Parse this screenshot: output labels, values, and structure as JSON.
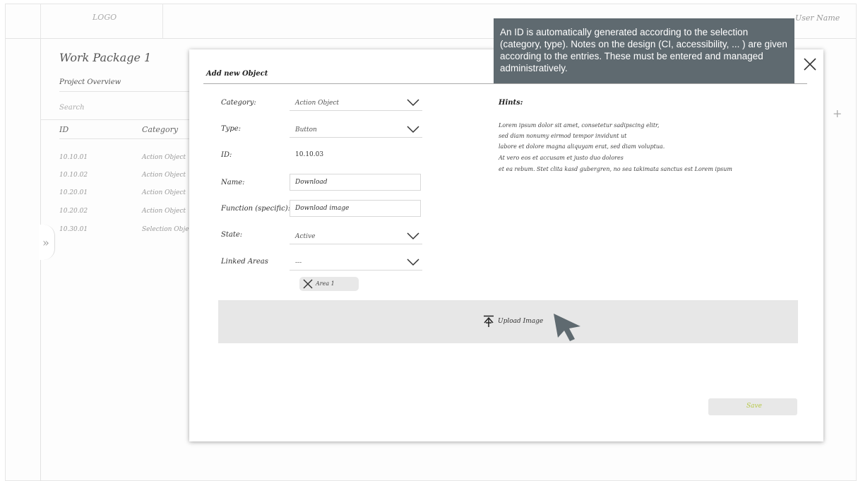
{
  "app": {
    "logo_text": "LOGO",
    "user_name": "User Name"
  },
  "sidebar": {
    "expand_icon": "double-chevron-right-icon",
    "expand_glyph": "»"
  },
  "background": {
    "work_package_title": "Work Package 1",
    "project_overview_label": "Project Overview",
    "search_placeholder": "Search",
    "add_icon": "+",
    "table": {
      "headers": [
        "ID",
        "Category"
      ],
      "rows": [
        [
          "10.10.01",
          "Action Object"
        ],
        [
          "10.10.02",
          "Action Object"
        ],
        [
          "10.20.01",
          "Action Object"
        ],
        [
          "10.20.02",
          "Action Object"
        ],
        [
          "10.30.01",
          "Selection Object"
        ]
      ]
    }
  },
  "modal": {
    "title": "Add new Object",
    "close_icon": "close-icon",
    "fields": {
      "category": {
        "label": "Category:",
        "value": "Action Object"
      },
      "type": {
        "label": "Type:",
        "value": "Button"
      },
      "id": {
        "label": "ID:",
        "value": "10.10.03"
      },
      "name": {
        "label": "Name:",
        "value": "Download"
      },
      "function": {
        "label": "Function (specific):",
        "value": "Download image"
      },
      "state": {
        "label": "State:",
        "value": "Active"
      },
      "linked_areas": {
        "label": "Linked Areas",
        "value": "---"
      }
    },
    "chip": {
      "label": "Area 1",
      "icon": "close-icon"
    },
    "hints": {
      "title": "Hints:",
      "lines": [
        "Lorem ipsum dolor sit amet, consetetur sadipscing elitr,",
        "sed diam nonumy eirmod tempor invidunt ut",
        "labore et dolore magna aliquyam erat, sed diam voluptua.",
        "At vero eos et accusam et justo duo dolores",
        "et ea rebum. Stet clita kasd gubergren, no sea takimata sanctus est Lorem ipsum"
      ]
    },
    "upload": {
      "label": "Upload Image",
      "icon": "upload-icon"
    },
    "save_label": "Save"
  },
  "tooltip": {
    "text": "An ID is automatically generated according to the selection (category, type). Notes on the design (CI, accessibility, ... ) are given according to the entries. These must be entered and managed administratively."
  },
  "colors": {
    "tooltip_bg": "#5f6a70",
    "save_text": "#b7c94a",
    "upload_zone": "#e7e7e7"
  }
}
